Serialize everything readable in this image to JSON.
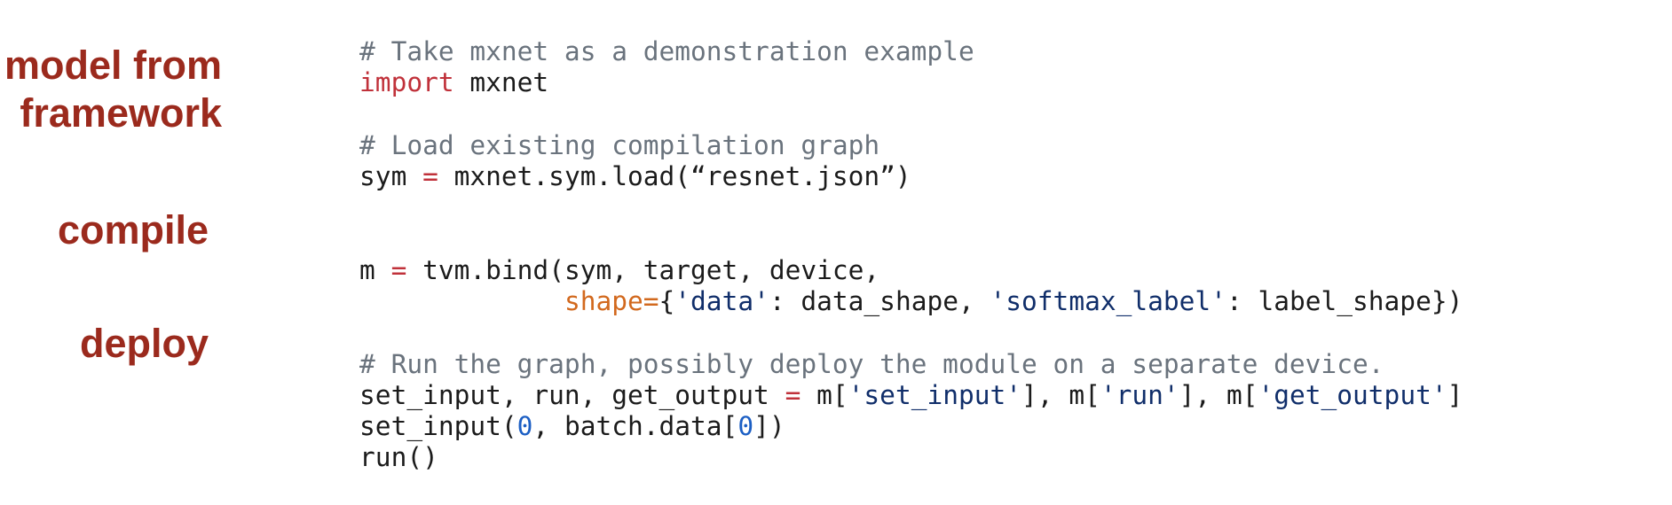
{
  "labels": {
    "model_line1": "model from",
    "model_line2": "framework",
    "compile": "compile",
    "deploy": "deploy"
  },
  "code": {
    "line1_comment": "# Take mxnet as a demonstration example",
    "line2_keyword": "import",
    "line2_rest": " mxnet",
    "line3_comment": "# Load existing compilation graph",
    "line4_a": "sym ",
    "line4_op": "=",
    "line4_b": " mxnet.sym.load(“resnet.json”)",
    "line5_a": "m ",
    "line5_op": "=",
    "line5_b": " tvm.bind(sym, target, device,",
    "line6_indent": "             ",
    "line6_arg": "shape=",
    "line6_b": "{",
    "line6_s1": "'data'",
    "line6_c": ": data_shape, ",
    "line6_s2": "'softmax_label'",
    "line6_d": ": label_shape})",
    "line7_comment": "# Run the graph, possibly deploy the module on a separate device.",
    "line8_a": "set_input, run, get_output ",
    "line8_op": "=",
    "line8_b": " m[",
    "line8_s1": "'set_input'",
    "line8_c": "], m[",
    "line8_s2": "'run'",
    "line8_d": "], m[",
    "line8_s3": "'get_output'",
    "line8_e": "]",
    "line9_a": "set_input(",
    "line9_n1": "0",
    "line9_b": ", batch.data[",
    "line9_n2": "0",
    "line9_c": "])",
    "line10": "run()"
  }
}
